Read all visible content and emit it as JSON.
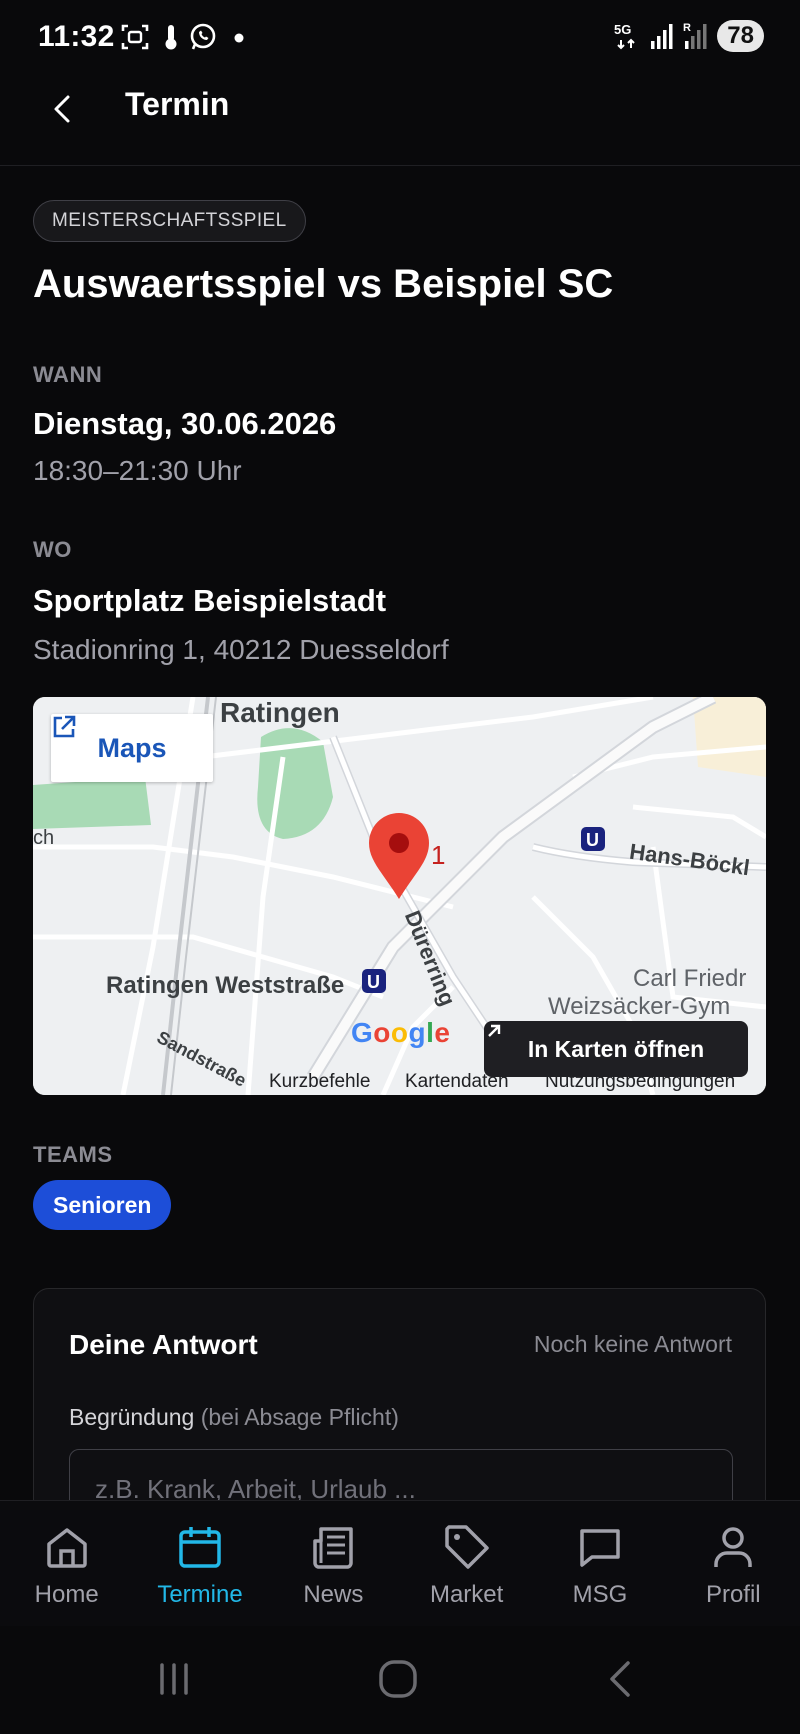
{
  "status_bar": {
    "time": "11:32",
    "network": "5G",
    "battery": "78",
    "icons": [
      "screenshot-icon",
      "thermometer-icon",
      "whatsapp-icon",
      "dot-icon",
      "signal-icon",
      "roaming-signal-icon"
    ]
  },
  "header": {
    "title": "Termin",
    "back_icon": "chevron-left-icon"
  },
  "event": {
    "badge": "MEISTERSCHAFTSSPIEL",
    "title": "Auswaertsspiel vs Beispiel SC"
  },
  "when": {
    "label": "WANN",
    "date": "Dienstag, 30.06.2026",
    "time": "18:30–21:30 Uhr"
  },
  "where": {
    "label": "WO",
    "venue": "Sportplatz Beispielstadt",
    "address": "Stadionring 1, 40212 Duesseldorf"
  },
  "map": {
    "maps_link": "Maps",
    "open_button": "In Karten öffnen",
    "marker_label": "1",
    "google_logo": "Google",
    "labels": {
      "ratingen": "Ratingen",
      "weststrasse": "Ratingen Weststraße",
      "duerer": "Dürerring",
      "hans": "Hans-Böckl",
      "carl": "Carl Friedr",
      "weizsaecker": "Weizsäcker-Gym",
      "sand": "Sandstraße",
      "edge": "ch"
    },
    "footer": {
      "shortcuts": "Kurzbefehle",
      "mapdata": "Kartendaten",
      "terms": "Nutzungsbedingungen"
    },
    "colors": {
      "road": "#ffffff",
      "park": "#a8dab5",
      "marker": "#ea4335",
      "transit": "#1a237e"
    }
  },
  "teams": {
    "label": "TEAMS",
    "items": [
      "Senioren"
    ]
  },
  "answer": {
    "title": "Deine Antwort",
    "status": "Noch keine Antwort",
    "reason_label": "Begründung",
    "reason_hint": "(bei Absage Pflicht)",
    "reason_placeholder": "z.B. Krank, Arbeit, Urlaub ..."
  },
  "bottom_nav": {
    "items": [
      {
        "label": "Home",
        "icon": "home-icon",
        "active": false
      },
      {
        "label": "Termine",
        "icon": "calendar-icon",
        "active": true
      },
      {
        "label": "News",
        "icon": "newspaper-icon",
        "active": false
      },
      {
        "label": "Market",
        "icon": "tag-icon",
        "active": false
      },
      {
        "label": "MSG",
        "icon": "message-icon",
        "active": false
      },
      {
        "label": "Profil",
        "icon": "user-icon",
        "active": false
      }
    ]
  },
  "system_nav": {
    "icons": [
      "recents-icon",
      "home-circle-icon",
      "back-icon"
    ]
  },
  "colors": {
    "background": "#09090b",
    "accent": "#22b8e8",
    "chip": "#1d4ed8"
  }
}
